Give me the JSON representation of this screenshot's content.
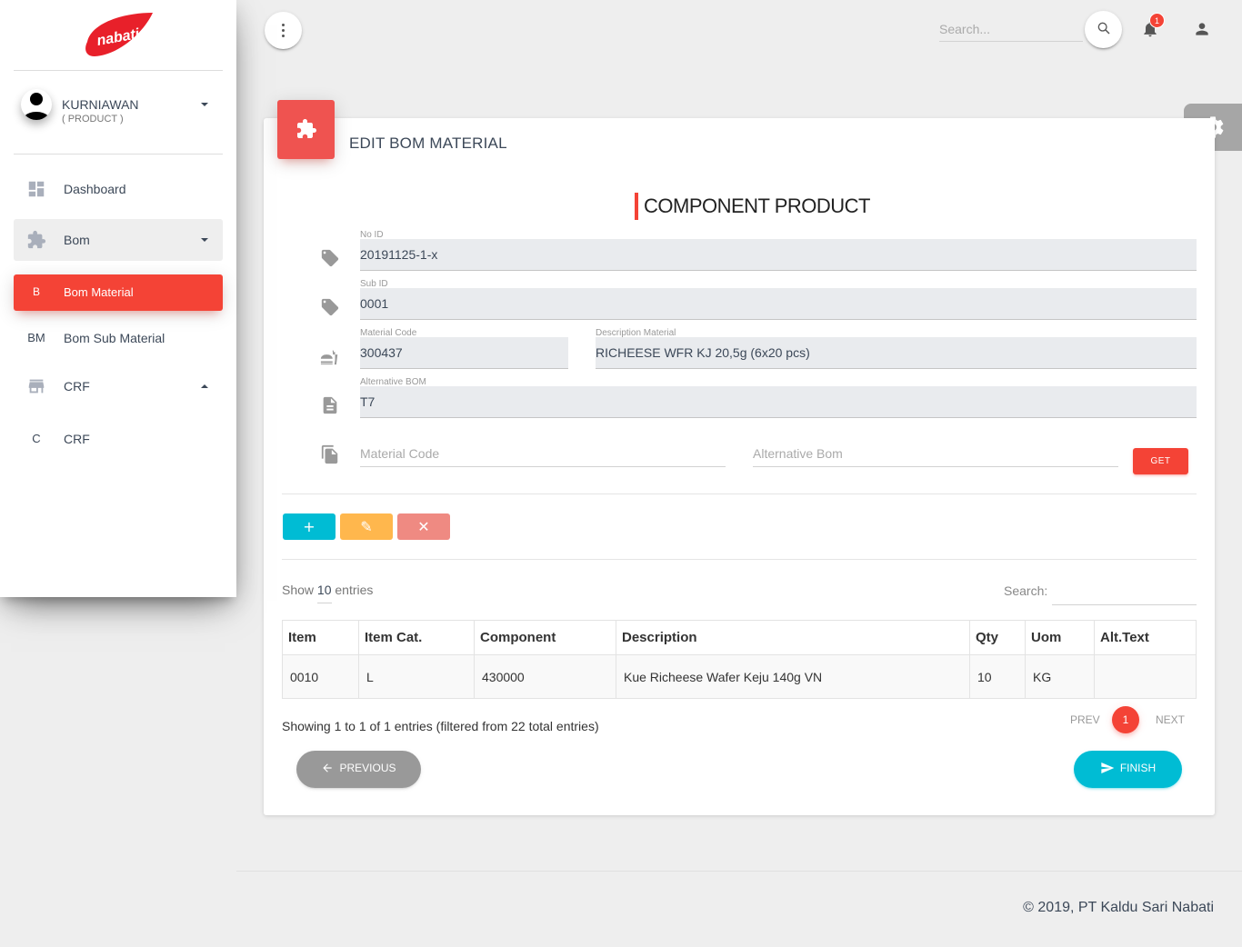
{
  "brand": {
    "logo_text": "nabati",
    "accent": "#f44336"
  },
  "user": {
    "name": "KURNIAWAN",
    "role": "( PRODUCT )"
  },
  "sidebar": {
    "items": [
      {
        "mini": "",
        "label": "Dashboard",
        "icon": "dashboard-icon"
      },
      {
        "mini": "",
        "label": "Bom",
        "icon": "puzzle-icon"
      },
      {
        "mini": "B",
        "label": "Bom Material"
      },
      {
        "mini": "BM",
        "label": "Bom Sub Material"
      },
      {
        "mini": "",
        "label": "CRF",
        "icon": "store-icon"
      },
      {
        "mini": "C",
        "label": "CRF"
      }
    ]
  },
  "topbar": {
    "search_placeholder": "Search...",
    "notification_count": "1"
  },
  "card": {
    "title": "EDIT BOM MATERIAL",
    "section_title": "COMPONENT PRODUCT"
  },
  "form": {
    "no_id_label": "No ID",
    "no_id_value": "20191125-1-x",
    "sub_id_label": "Sub ID",
    "sub_id_value": "0001",
    "material_code_label": "Material Code",
    "material_code_value": "300437",
    "description_label": "Description Material",
    "description_value": "RICHEESE WFR KJ 20,5g (6x20 pcs)",
    "alt_bom_label": "Alternative BOM",
    "alt_bom_value": "T7",
    "lookup_material_placeholder": "Material Code",
    "lookup_alt_placeholder": "Alternative Bom",
    "get_label": "GET"
  },
  "actions": {
    "add": "+",
    "edit": "✎",
    "delete": "✕"
  },
  "table": {
    "show_prefix": "Show",
    "show_value": "10",
    "show_suffix": "entries",
    "search_label": "Search:",
    "headers": [
      "Item",
      "Item Cat.",
      "Component",
      "Description",
      "Qty",
      "Uom",
      "Alt.Text"
    ],
    "rows": [
      [
        "0010",
        "L",
        "430000",
        "Kue Richeese Wafer Keju 140g VN",
        "10",
        "KG",
        ""
      ]
    ],
    "info": "Showing 1 to 1 of 1 entries (filtered from 22 total entries)",
    "prev": "PREV",
    "page": "1",
    "next": "NEXT"
  },
  "wizard": {
    "previous": "PREVIOUS",
    "finish": "FINISH"
  },
  "footer": {
    "copyright": "© 2019, PT Kaldu Sari Nabati"
  }
}
